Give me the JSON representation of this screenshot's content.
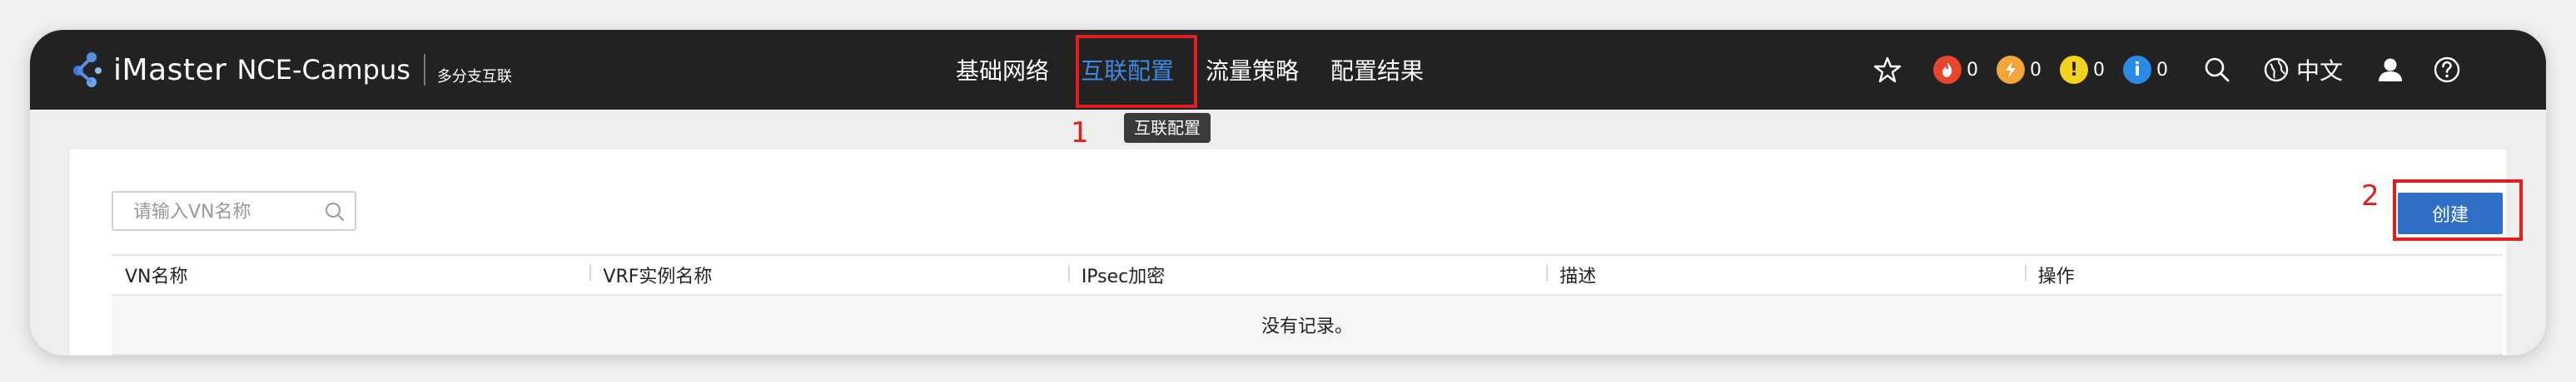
{
  "brand": {
    "name": "iMaster",
    "product": "NCE-Campus",
    "subtitle": "多分支互联"
  },
  "nav": {
    "items": [
      {
        "label": "基础网络",
        "active": false
      },
      {
        "label": "互联配置",
        "active": true
      },
      {
        "label": "流量策略",
        "active": false
      },
      {
        "label": "配置结果",
        "active": false
      }
    ],
    "tooltip": "互联配置"
  },
  "annotations": {
    "step1": "1",
    "step2": "2"
  },
  "toolbar": {
    "alarms": [
      {
        "type": "critical",
        "icon": "fire-icon",
        "color": "#e8452e",
        "count": "0"
      },
      {
        "type": "major",
        "icon": "bolt-icon",
        "color": "#f2a53a",
        "count": "0"
      },
      {
        "type": "minor",
        "icon": "exclamation-icon",
        "color": "#f4d31f",
        "count": "0"
      },
      {
        "type": "info",
        "icon": "info-icon",
        "color": "#2a8be6",
        "count": "0"
      }
    ],
    "language": "中文"
  },
  "main": {
    "search": {
      "placeholder": "请输入VN名称",
      "value": ""
    },
    "create_label": "创建",
    "table": {
      "columns": [
        "VN名称",
        "VRF实例名称",
        "IPsec加密",
        "描述",
        "操作"
      ],
      "rows": [],
      "empty_text": "没有记录。"
    }
  },
  "colors": {
    "topbar": "#222222",
    "accent": "#2f6fc8",
    "nav_active": "#3d8ae6",
    "highlight": "#e02020"
  }
}
